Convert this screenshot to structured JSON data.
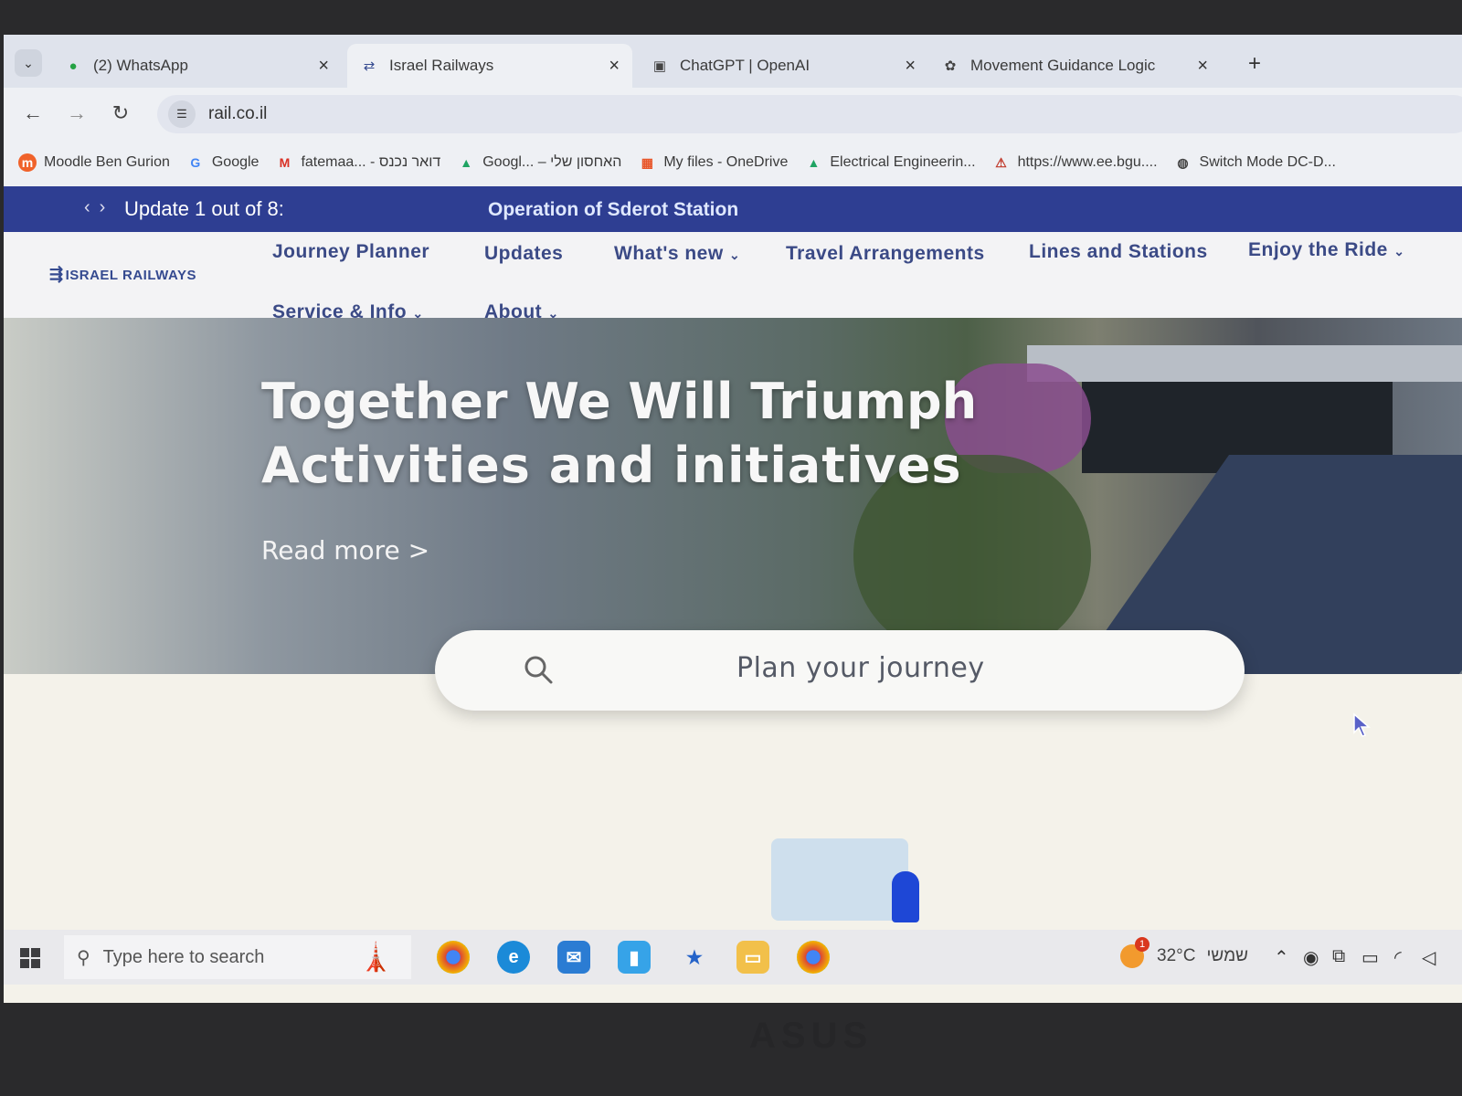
{
  "tabs": [
    {
      "icon": "whatsapp-icon",
      "label": "(2) WhatsApp"
    },
    {
      "icon": "train-icon",
      "label": "Israel Railways"
    },
    {
      "icon": "chatgpt-icon",
      "label": "ChatGPT | OpenAI"
    },
    {
      "icon": "openai-icon",
      "label": "Movement Guidance Logic"
    }
  ],
  "address": {
    "url": "rail.co.il"
  },
  "bookmarks": [
    {
      "icon": "moodle-icon",
      "label": "Moodle Ben Gurion"
    },
    {
      "icon": "google-icon",
      "label": "Google"
    },
    {
      "icon": "gmail-icon",
      "label": "fatemaa... - דואר נכנס"
    },
    {
      "icon": "drive-icon",
      "label": "Googl... – האחסון שלי"
    },
    {
      "icon": "microsoft-icon",
      "label": "My files - OneDrive"
    },
    {
      "icon": "drive-icon",
      "label": "Electrical Engineerin..."
    },
    {
      "icon": "pma-icon",
      "label": "https://www.ee.bgu...."
    },
    {
      "icon": "globe-icon",
      "label": "Switch Mode DC-D..."
    }
  ],
  "banner": {
    "update": "Update 1 out of 8:",
    "message": "Operation of Sderot Station"
  },
  "site": {
    "logo": "ISRAEL RAILWAYS",
    "nav": {
      "journey_planner": "Journey Planner",
      "updates": "Updates",
      "whats_new": "What's new",
      "travel_arrangements": "Travel Arrangements",
      "lines_and_stations": "Lines and Stations",
      "enjoy_the_ride": "Enjoy the Ride",
      "service_info": "Service & Info",
      "about": "About"
    },
    "hero": {
      "title_line1": "Together We Will Triumph",
      "title_line2": "Activities and initiatives",
      "read_more": "Read more >"
    },
    "search": {
      "placeholder": "Plan your journey"
    }
  },
  "taskbar": {
    "search_placeholder": "Type here to search",
    "temperature": "32°C",
    "weather_label": "שמשי",
    "weather_alert": "1"
  },
  "colors": {
    "banner": "#2e3e92",
    "nav_text": "#3b4a86",
    "tabstrip": "#dfe3ec"
  }
}
